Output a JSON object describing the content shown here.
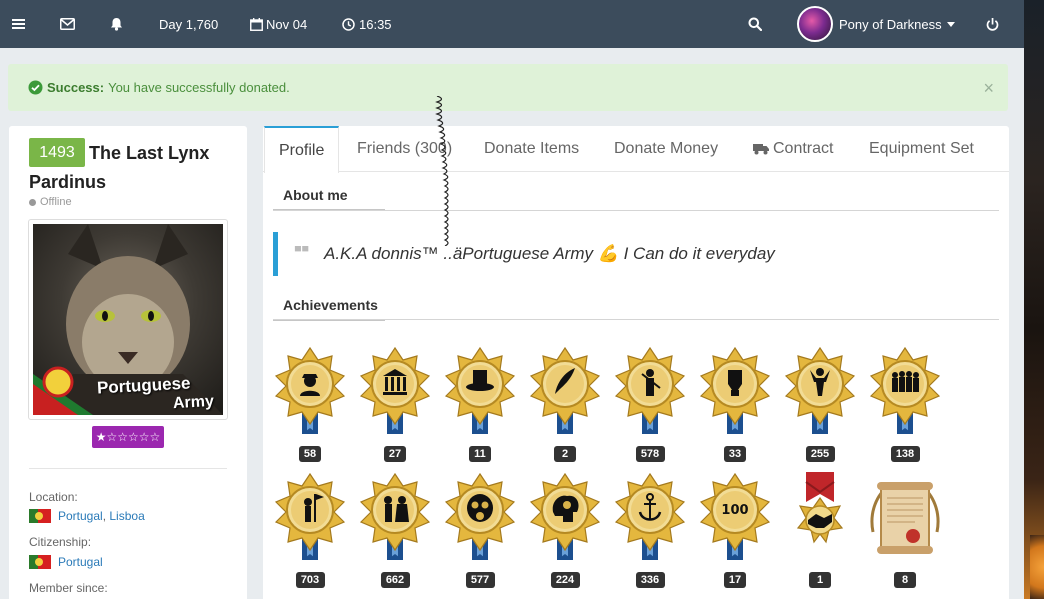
{
  "navbar": {
    "menu_icon": "hamburger-icon",
    "mail_icon": "envelope-icon",
    "bell_icon": "bell-icon",
    "day": "Day 1,760",
    "date": "Nov 04",
    "time": "16:35",
    "username": "Pony of Darkness"
  },
  "alert": {
    "strong": "Success:",
    "message": "You have successfully donated.",
    "close": "×"
  },
  "profile": {
    "level": "1493",
    "name": "The Last Lynx Pardinus",
    "status": "Offline",
    "avatar_caption_1": "Portuguese",
    "avatar_caption_2": "Army",
    "stars": "★☆☆☆☆☆",
    "location_label": "Location:",
    "location_country": "Portugal",
    "location_region": "Lisboa",
    "citizenship_label": "Citizenship:",
    "citizenship_value": "Portugal",
    "member_since_label": "Member since:"
  },
  "tabs": [
    {
      "label": "Profile",
      "active": true
    },
    {
      "label": "Friends (300)",
      "active": false
    },
    {
      "label": "Donate Items",
      "active": false
    },
    {
      "label": "Donate Money",
      "active": false
    },
    {
      "label": "Contract",
      "active": false
    },
    {
      "label": "Equipment Set",
      "active": false
    }
  ],
  "about": {
    "title": "About me",
    "quote": "A.K.A donnis™ ..äPortuguese Army 💪 I Can do it everyday"
  },
  "achievements": {
    "title": "Achievements",
    "row1": [
      {
        "icon": "soldier-icon",
        "count": "58"
      },
      {
        "icon": "building-icon",
        "count": "27"
      },
      {
        "icon": "top-hat-icon",
        "count": "11"
      },
      {
        "icon": "quill-icon",
        "count": "2"
      },
      {
        "icon": "rifleman-icon",
        "count": "578"
      },
      {
        "icon": "fist-icon",
        "count": "33"
      },
      {
        "icon": "strongman-icon",
        "count": "255"
      },
      {
        "icon": "troops-icon",
        "count": "138"
      }
    ],
    "row2": [
      {
        "icon": "flag-bearer-icon",
        "count": "703"
      },
      {
        "icon": "couple-icon",
        "count": "662"
      },
      {
        "icon": "gas-mask-icon",
        "count": "577"
      },
      {
        "icon": "brain-icon",
        "count": "224"
      },
      {
        "icon": "anchor-icon",
        "count": "336"
      },
      {
        "icon": "hundred-icon",
        "count": "17"
      },
      {
        "icon": "handshake-medal-icon",
        "count": "1"
      },
      {
        "icon": "scroll-icon",
        "count": "8"
      }
    ]
  },
  "colors": {
    "navbar": "#3c4c5c",
    "accent": "#2a9fd6",
    "level": "#7ab648",
    "stars_bg": "#9b27af",
    "success_bg": "#dff2d8"
  }
}
